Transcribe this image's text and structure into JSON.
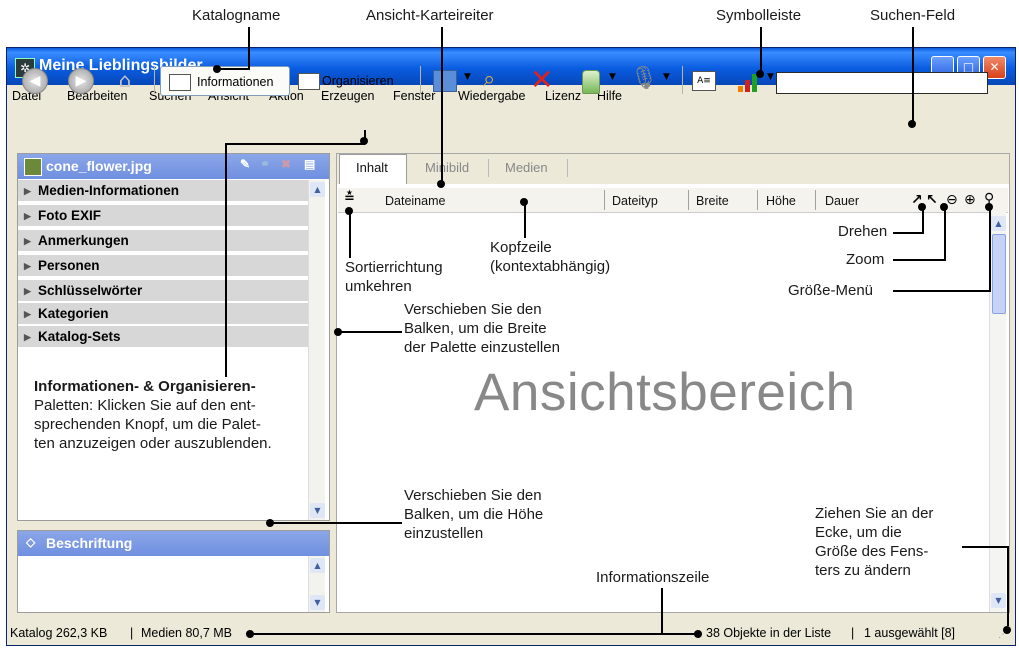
{
  "annotations": {
    "katalogname": "Katalogname",
    "ansicht_karteireiter": "Ansicht-Karteireiter",
    "symbolleiste": "Symbolleiste",
    "suchen_feld": "Suchen-Feld",
    "drehen": "Drehen",
    "zoom": "Zoom",
    "groesse_menue": "Größe-Menü",
    "kopfzeile_1": "Kopfzeile",
    "kopfzeile_2": "(kontextabhängig)",
    "sortier_1": "Sortierrichtung",
    "sortier_2": "umkehren",
    "balken_breite_1": "Verschieben Sie den",
    "balken_breite_2": "Balken, um die Breite",
    "balken_breite_3": "der Palette einzustellen",
    "paletten_title": "Informationen- & Organisieren-",
    "paletten_2": "Paletten: Klicken Sie auf den ent-",
    "paletten_3": "sprechenden Knopf, um die Palet-",
    "paletten_4": "ten anzuzeigen oder auszublenden.",
    "balken_hoehe_1": "Verschieben Sie den",
    "balken_hoehe_2": "Balken, um die Höhe",
    "balken_hoehe_3": "einzustellen",
    "ecke_1": "Ziehen Sie an der",
    "ecke_2": "Ecke, um die",
    "ecke_3": "Größe des Fens-",
    "ecke_4": "ters zu ändern",
    "informationszeile": "Informationszeile",
    "ansichtsbereich": "Ansichtsbereich"
  },
  "window": {
    "title": "Meine Lieblingsbilder",
    "accent": "#0a5ce0"
  },
  "menu": [
    "Datei",
    "Bearbeiten",
    "Suchen",
    "Ansicht",
    "Aktion",
    "Erzeugen",
    "Fenster",
    "Wiedergabe",
    "Lizenz",
    "Hilfe"
  ],
  "toolbar": {
    "informationen": "Informationen",
    "organisieren": "Organisieren",
    "search_value": ""
  },
  "info_panel": {
    "filename": "cone_flower.jpg",
    "sections": [
      "Medien-Informationen",
      "Foto EXIF",
      "Anmerkungen",
      "Personen",
      "Schlüsselwörter",
      "Kategorien",
      "Katalog-Sets"
    ]
  },
  "caption_panel": {
    "title": "Beschriftung"
  },
  "view": {
    "tabs": [
      "Inhalt",
      "Minibild",
      "Medien"
    ],
    "columns": [
      "Dateiname",
      "Dateityp",
      "Breite",
      "Höhe",
      "Dauer"
    ]
  },
  "status": {
    "katalog": "Katalog  262,3 KB",
    "medien": "Medien 80,7 MB",
    "objekte": "38 Objekte in der Liste",
    "ausgewaehlt": "1 ausgewählt [8]"
  }
}
